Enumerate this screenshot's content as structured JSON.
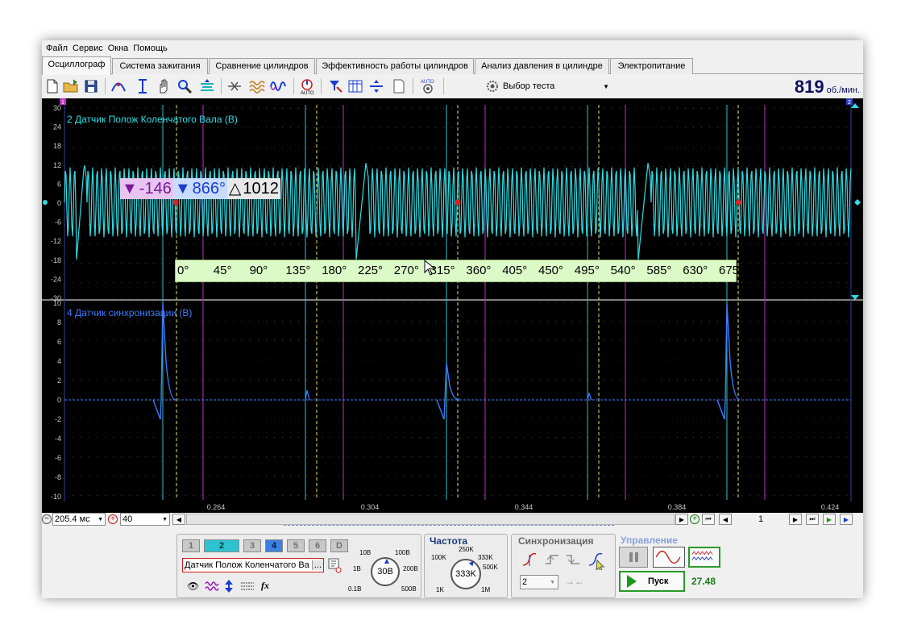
{
  "menu": [
    "Файл",
    "Сервис",
    "Окна",
    "Помощь"
  ],
  "tabs": [
    {
      "label": "Осциллограф",
      "active": true
    },
    {
      "label": "Система зажигания",
      "active": false
    },
    {
      "label": "Сравнение цилиндров",
      "active": false
    },
    {
      "label": "Эффективность работы цилиндров",
      "active": false
    },
    {
      "label": "Анализ давления в цилиндре",
      "active": false
    },
    {
      "label": "Электропитание",
      "active": false
    }
  ],
  "toolbar": {
    "icons": [
      "new-file-icon",
      "open-folder-icon",
      "save-icon",
      "trigger-icon",
      "cursor-icon",
      "hand-icon",
      "zoom-icon",
      "auto-scale-icon",
      "compress-icon",
      "filter-icon",
      "waveform-icon",
      "auto-icon",
      "flag-icon",
      "table-icon",
      "split-icon",
      "page-icon",
      "auto-settings-icon"
    ],
    "test_select": "Выбор теста",
    "rpm_value": "819",
    "rpm_unit": "об./мин."
  },
  "plot": {
    "channel_top": {
      "label": "2 Датчик Полож Коленчатого Вала (В)",
      "color": "#2fdde5",
      "ylim": [
        -30,
        30
      ],
      "ticks": [
        30,
        24,
        18,
        12,
        6,
        0,
        -6,
        -12,
        -18,
        -24,
        -30
      ]
    },
    "channel_bottom": {
      "label": "4 Датчик синхронизации (В)",
      "color": "#3a7cff",
      "ylim": [
        -10,
        10
      ],
      "ticks": [
        10,
        8,
        6,
        4,
        2,
        0,
        -2,
        -4,
        -6,
        -8,
        -10
      ]
    },
    "cursor_readout": {
      "marker1": "-146",
      "marker2": "866°",
      "delta_symbol": "△",
      "delta": "1012"
    },
    "angle_scale": [
      "0°",
      "45°",
      "90°",
      "135°",
      "180°",
      "225°",
      "270°",
      "315°",
      "360°",
      "405°",
      "450°",
      "495°",
      "540°",
      "585°",
      "630°",
      "675°"
    ],
    "time_axis": [
      "0.264",
      "0.304",
      "0.344",
      "0.384",
      "0.424"
    ],
    "top_marker_left": "1",
    "top_marker_right": "2"
  },
  "timebar": {
    "time_per_div": "205.4 мс",
    "zoom_value": "40",
    "page_number": "1"
  },
  "channels_panel": {
    "buttons": [
      {
        "label": "1",
        "state": "off"
      },
      {
        "label": "2",
        "state": "on"
      },
      {
        "label": "3",
        "state": "off"
      },
      {
        "label": "4",
        "state": "on4"
      },
      {
        "label": "5",
        "state": "off"
      },
      {
        "label": "6",
        "state": "off"
      },
      {
        "label": "D",
        "state": "off"
      }
    ],
    "sensor_name": "Датчик Полож Коленчатого Ва",
    "sensor_more": "...",
    "fx_label": "fx",
    "volt_knob": {
      "value": "30В",
      "labels": [
        "10В",
        "100В",
        "1В",
        "200В",
        "0.1В",
        "500В"
      ]
    }
  },
  "frequency_panel": {
    "title": "Частота",
    "knob_value": "333K",
    "labels": [
      "250K",
      "100K",
      "333K",
      "500K",
      "1K",
      "1M"
    ]
  },
  "sync_panel": {
    "title": "Синхронизация",
    "channel_value": "2"
  },
  "control_panel": {
    "title": "Управление",
    "start_label": "Пуск",
    "counter": "27.48"
  }
}
